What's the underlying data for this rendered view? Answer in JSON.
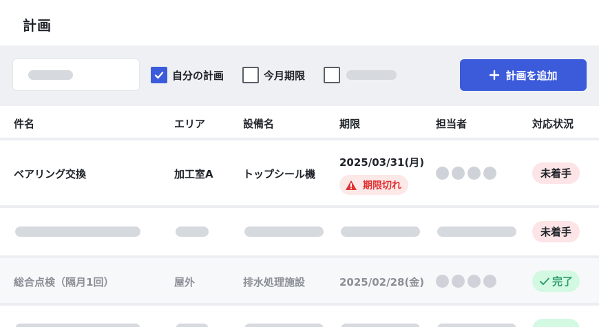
{
  "page": {
    "title": "計画"
  },
  "toolbar": {
    "filters": [
      {
        "label": "自分の計画",
        "checked": true
      },
      {
        "label": "今月期限",
        "checked": false
      },
      {
        "label": "",
        "checked": false
      }
    ],
    "add_button": {
      "icon": "plus-icon",
      "label": "計画を追加"
    }
  },
  "table": {
    "columns": [
      "件名",
      "エリア",
      "設備名",
      "期限",
      "担当者",
      "対応状況"
    ],
    "rows": [
      {
        "title": "ベアリング交換",
        "area": "加工室A",
        "equipment": "トップシール機",
        "due": "2025/03/31(月)",
        "due_badge": "期限切れ",
        "status": "未着手"
      },
      {
        "title": "",
        "area": "",
        "equipment": "",
        "due": "",
        "status": "未着手"
      },
      {
        "title": "総合点検（隔月1回）",
        "area": "屋外",
        "equipment": "排水処理施設",
        "due": "2025/02/28(金)",
        "status": "完了"
      }
    ]
  },
  "colors": {
    "accent": "#3b5bdb",
    "overdue": "#e03131",
    "todo_bg": "#fde4e6",
    "done": "#2f9e6b"
  }
}
